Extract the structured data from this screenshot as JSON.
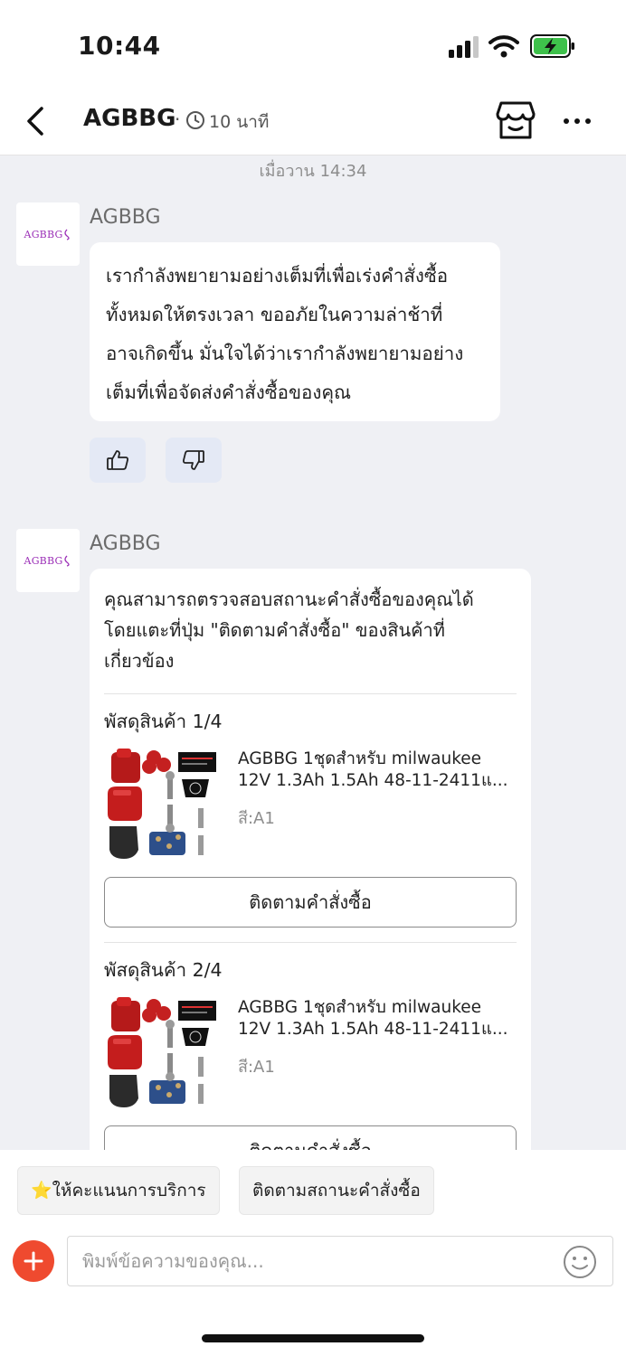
{
  "status_bar": {
    "time": "10:44"
  },
  "header": {
    "shop_name": "AGBBG",
    "separator": "·",
    "last_seen": "10 นาที"
  },
  "chat": {
    "date_separator": "เมื่อวาน 14:34",
    "messages": [
      {
        "avatar_text": "AGBBG",
        "sender": "AGBBG",
        "lines": [
          "เรากำลังพยายามอย่างเต็มที่เพื่อเร่งคำสั่งซื้อ",
          "ทั้งหมดให้ตรงเวลา ขออภัยในความล่าช้าที่",
          "อาจเกิดขึ้น มั่นใจได้ว่าเรากำลังพยายามอย่าง",
          "เต็มที่เพื่อจัดส่งคำสั่งซื้อของคุณ"
        ]
      },
      {
        "avatar_text": "AGBBG",
        "sender": "AGBBG",
        "lines": [
          "คุณสามารถตรวจสอบสถานะคำสั่งซื้อของคุณได้",
          "โดยแตะที่ปุ่ม \"ติดตามคำสั่งซื้อ\" ของสินค้าที่",
          "เกี่ยวข้อง"
        ],
        "packages": [
          {
            "title": "พัสดุสินค้า 1/4",
            "name_line1": "AGBBG 1ชุดสำหรับ milwaukee",
            "name_line2": "12V 1.3Ah 1.5Ah 48-11-2411แ...",
            "variant": "สี:A1",
            "button": "ติดตามคำสั่งซื้อ"
          },
          {
            "title": "พัสดุสินค้า 2/4",
            "name_line1": "AGBBG 1ชุดสำหรับ milwaukee",
            "name_line2": "12V 1.3Ah 1.5Ah 48-11-2411แ...",
            "variant": "สี:A1",
            "button": "ติดตามคำสั่งซื้อ"
          }
        ]
      }
    ]
  },
  "quick_replies": [
    "⭐ให้คะแนนการบริการ",
    "ติดตามสถานะคำสั่งซื้อ"
  ],
  "composer": {
    "placeholder": "พิมพ์ข้อความของคุณ..."
  },
  "colors": {
    "accent": "#ef4a2f",
    "chat_bg": "#eff0f4",
    "feedback_bg": "#e4e9f5",
    "avatar_text": "#9b2fb7"
  }
}
